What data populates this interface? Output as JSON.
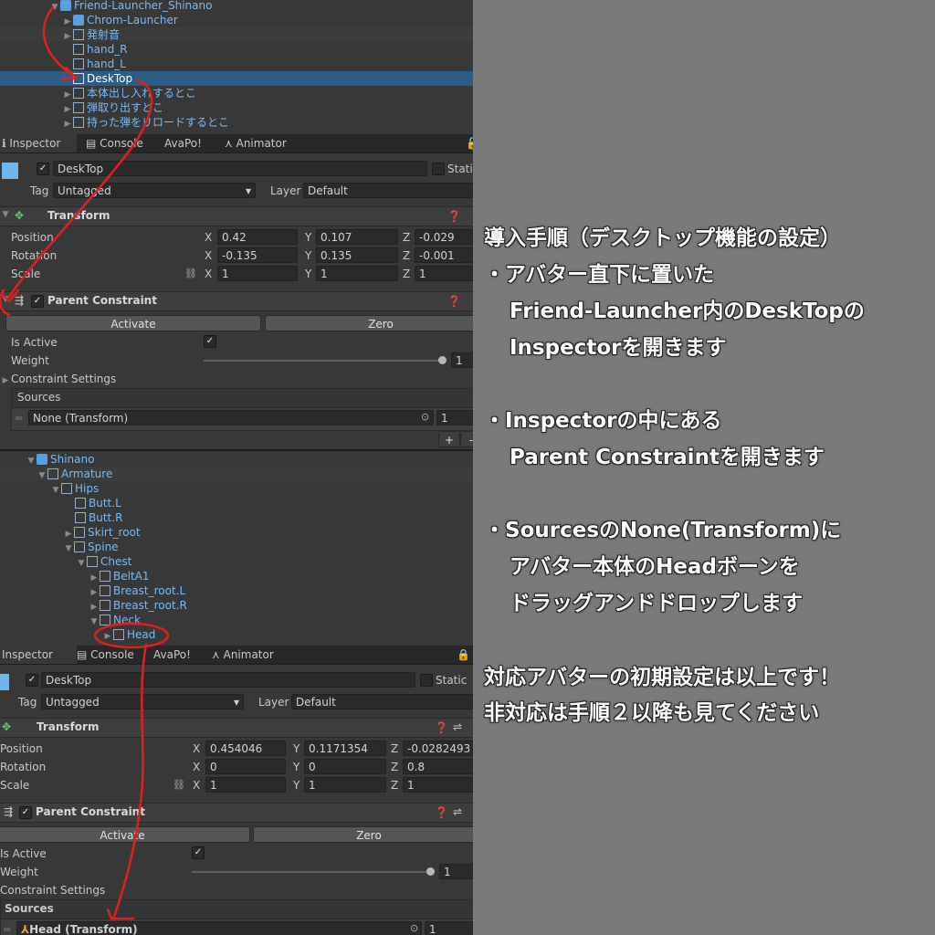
{
  "hierarchy_top": {
    "root": "Friend-Launcher_Shinano",
    "items": [
      "Chrom-Launcher",
      "発射音",
      "hand_R",
      "hand_L",
      "DeskTop",
      "本体出し入れするとこ",
      "弾取り出すとこ",
      "持った弾をリロードするとこ"
    ],
    "selected": "DeskTop"
  },
  "tabs_top": [
    "Inspector",
    "Console",
    "AvaPo!",
    "Animator"
  ],
  "inspector_top": {
    "object_name": "DeskTop",
    "static_label": "Static",
    "tag_label": "Tag",
    "tag_value": "Untagged",
    "layer_label": "Layer",
    "layer_value": "Default",
    "transform_title": "Transform",
    "position_label": "Position",
    "rotation_label": "Rotation",
    "scale_label": "Scale",
    "position": {
      "x": "0.42",
      "y": "0.107",
      "z": "-0.029"
    },
    "rotation": {
      "x": "-0.135",
      "y": "0.135",
      "z": "-0.001"
    },
    "scale": {
      "x": "1",
      "y": "1",
      "z": "1"
    },
    "constraint_title": "Parent Constraint",
    "activate": "Activate",
    "zero": "Zero",
    "is_active": "Is Active",
    "weight": "Weight",
    "weight_value": "1",
    "constraint_settings": "Constraint Settings",
    "sources": "Sources",
    "source_value": "None (Transform)",
    "source_weight": "1",
    "plus": "+",
    "minus": "-"
  },
  "hierarchy_bottom": {
    "items": [
      "Shinano",
      "Armature",
      "Hips",
      "Butt.L",
      "Butt.R",
      "Skirt_root",
      "Spine",
      "Chest",
      "BeltA1",
      "Breast_root.L",
      "Breast_root.R",
      "Neck",
      "Head"
    ]
  },
  "tabs_bottom": [
    "Inspector",
    "Console",
    "AvaPo!",
    "Animator"
  ],
  "inspector_bottom": {
    "object_name": "DeskTop",
    "static_label": "Static",
    "tag_label": "Tag",
    "tag_value": "Untagged",
    "layer_label": "Layer",
    "layer_value": "Default",
    "transform_title": "Transform",
    "position_label": "Position",
    "rotation_label": "Rotation",
    "scale_label": "Scale",
    "position": {
      "x": "0.454046",
      "y": "0.1171354",
      "z": "-0.0282493"
    },
    "rotation": {
      "x": "0",
      "y": "0",
      "z": "0.8"
    },
    "scale": {
      "x": "1",
      "y": "1",
      "z": "1"
    },
    "constraint_title": "Parent Constraint",
    "activate": "Activate",
    "zero": "Zero",
    "is_active": "Is Active",
    "weight": "Weight",
    "weight_value": "1",
    "constraint_settings": "Constraint Settings",
    "sources": "Sources",
    "source_value": "Head (Transform)",
    "source_weight": "1"
  },
  "axis_labels": {
    "x": "X",
    "y": "Y",
    "z": "Z"
  },
  "instructions": {
    "heading": "導入手順（デスクトップ機能の設定）",
    "step1": [
      "・アバター直下に置いた",
      "Friend-Launcher内のDeskTopの",
      "Inspectorを開きます"
    ],
    "step2": [
      "・Inspectorの中にある",
      "Parent Constraintを開きます"
    ],
    "step3": [
      "・SourcesのNone(Transform)に",
      "アバター本体のHeadボーンを",
      "ドラッグアンドドロップします"
    ],
    "footer": [
      "対応アバターの初期設定は以上です！",
      "非対応は手順２以降も見てください"
    ]
  },
  "colors": {
    "panel": "#383838",
    "selection": "#2c5d87",
    "annotation": "#e02020",
    "right_bg": "#7a7a7a",
    "link_text": "#7cb8f0"
  }
}
